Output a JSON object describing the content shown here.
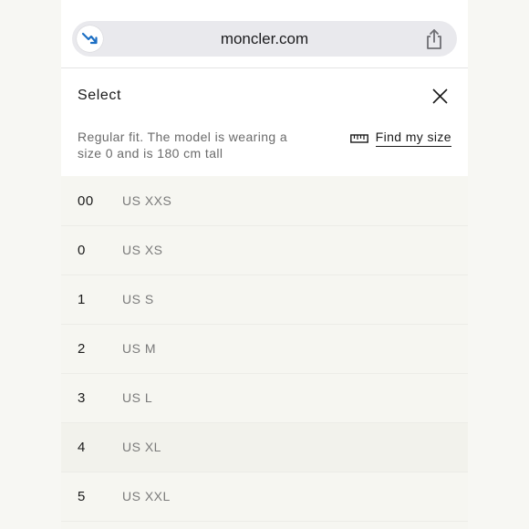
{
  "browser": {
    "url": "moncler.com",
    "site_icon": "trending-down-icon",
    "share_icon": "share-icon"
  },
  "sheet": {
    "title": "Select",
    "close_icon": "close-icon",
    "fit_note": "Regular fit. The model is wearing a size 0 and is 180 cm tall",
    "find_size_label": "Find my size",
    "find_size_icon": "ruler-icon"
  },
  "sizes": [
    {
      "code": "00",
      "us": "US XXS"
    },
    {
      "code": "0",
      "us": "US XS"
    },
    {
      "code": "1",
      "us": "US S"
    },
    {
      "code": "2",
      "us": "US M"
    },
    {
      "code": "3",
      "us": "US L"
    },
    {
      "code": "4",
      "us": "US XL"
    },
    {
      "code": "5",
      "us": "US XXL"
    }
  ],
  "colors": {
    "accent": "#1d6fc4",
    "background": "#f6f6f1",
    "text": "#1a1a1a",
    "muted": "#7a7a7a"
  }
}
